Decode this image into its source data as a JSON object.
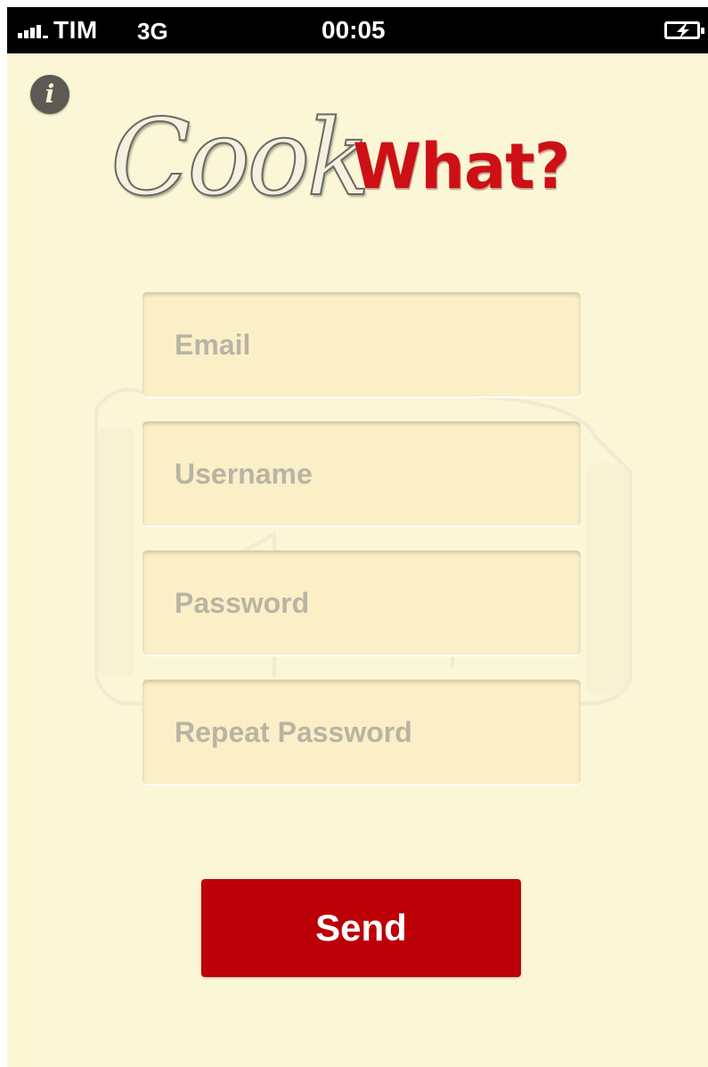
{
  "status_bar": {
    "carrier": "TIM",
    "network": "3G",
    "time": "00:05",
    "signal_icon": "signal-bars-icon",
    "battery_icon": "battery-charging-icon"
  },
  "app": {
    "info_icon": "info-icon",
    "info_glyph": "i",
    "logo": {
      "part1": "Cook",
      "part2": "What?"
    },
    "form": {
      "email_placeholder": "Email",
      "username_placeholder": "Username",
      "password_placeholder": "Password",
      "repeat_password_placeholder": "Repeat Password"
    },
    "send_label": "Send"
  },
  "colors": {
    "background": "#fbf6d6",
    "field_background": "#fbefc8",
    "accent_red": "#bb0007",
    "logo_red": "#cc1015"
  }
}
